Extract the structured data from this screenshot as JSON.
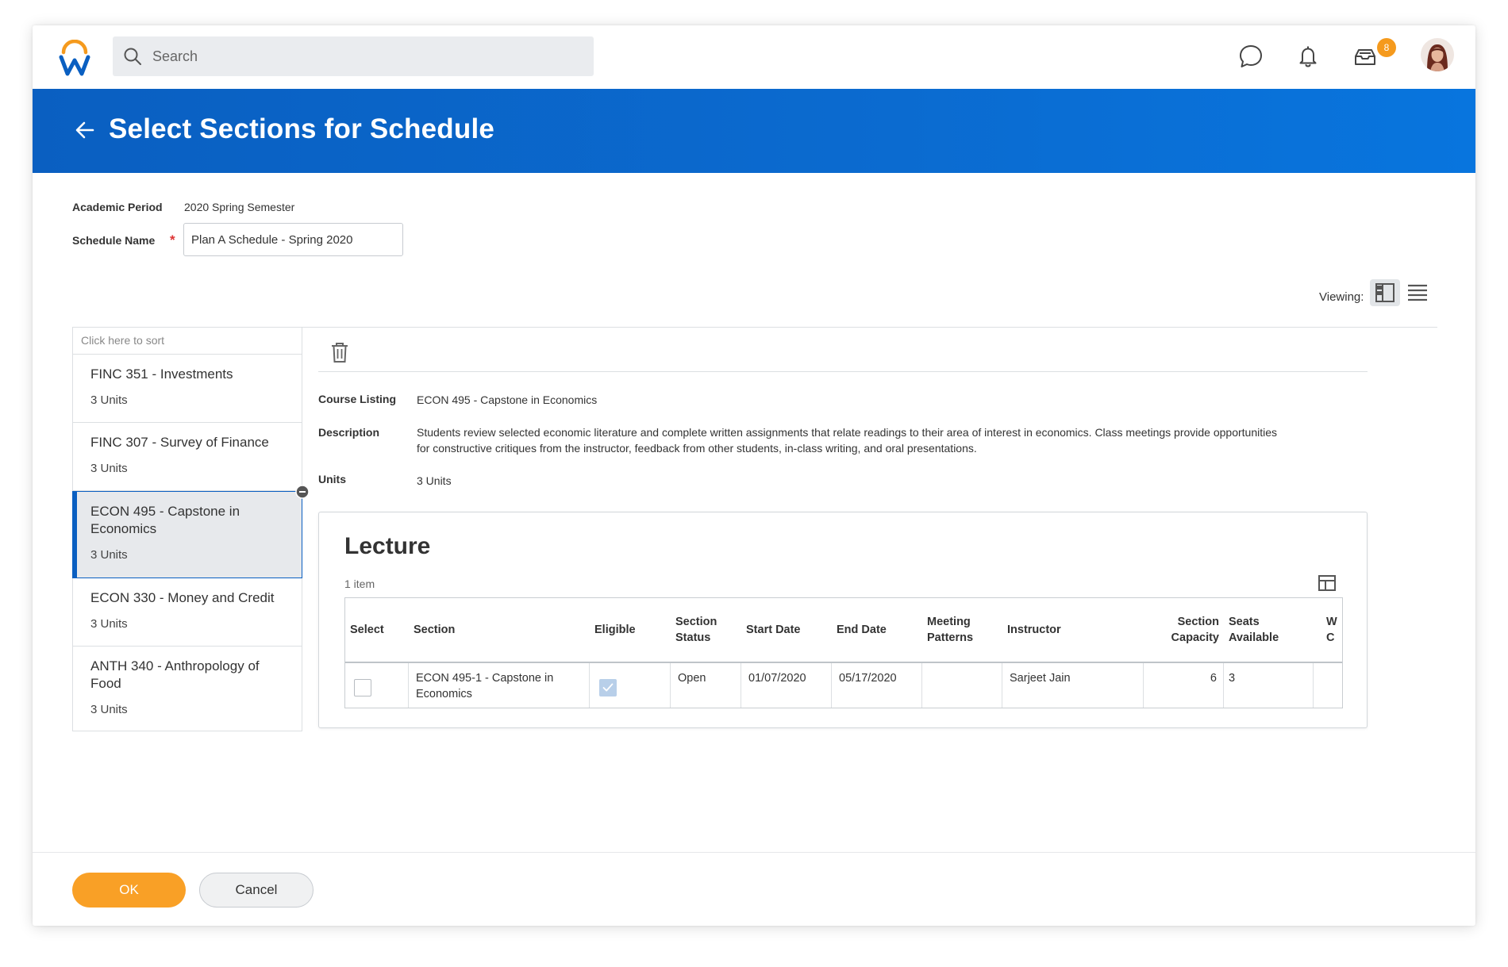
{
  "topnav": {
    "search_placeholder": "Search",
    "inbox_badge": "8"
  },
  "header": {
    "title": "Select Sections for Schedule"
  },
  "form": {
    "academic_period_label": "Academic Period",
    "academic_period_value": "2020 Spring Semester",
    "schedule_name_label": "Schedule Name",
    "required_marker": "*",
    "schedule_name_value": "Plan A Schedule - Spring 2020"
  },
  "viewing": {
    "label": "Viewing:"
  },
  "course_list": {
    "sort_hint": "Click here to sort",
    "items": [
      {
        "name": "FINC 351 - Investments",
        "units": "3 Units"
      },
      {
        "name": "FINC 307 - Survey of Finance",
        "units": "3 Units"
      },
      {
        "name": "ECON 495 - Capstone in Economics",
        "units": "3 Units"
      },
      {
        "name": "ECON 330 - Money and Credit",
        "units": "3 Units"
      },
      {
        "name": "ANTH 340 - Anthropology of Food",
        "units": "3 Units"
      }
    ]
  },
  "detail": {
    "course_listing_label": "Course Listing",
    "course_listing_value": "ECON 495 - Capstone in Economics",
    "description_label": "Description",
    "description_line1": "Students review selected economic literature and complete written assignments that relate readings to their area of interest in economics. Class meetings provide opportunities",
    "description_line2": "for constructive critiques from the instructor, feedback from other students, in-class writing, and oral presentations.",
    "units_label": "Units",
    "units_value": "3 Units"
  },
  "lecture": {
    "title": "Lecture",
    "item_count": "1 item",
    "columns": {
      "select": "Select",
      "section": "Section",
      "eligible": "Eligible",
      "status_1": "Section",
      "status_2": "Status",
      "start": "Start Date",
      "end": "End Date",
      "meeting_1": "Meeting",
      "meeting_2": "Patterns",
      "instructor": "Instructor",
      "capacity_1": "Section",
      "capacity_2": "Capacity",
      "seats_1": "Seats",
      "seats_2": "Available",
      "waitlist_1": "W",
      "waitlist_2": "C"
    },
    "row": {
      "selected": false,
      "section_1": "ECON 495-1 - Capstone in",
      "section_2": "Economics",
      "eligible": true,
      "status": "Open",
      "start": "01/07/2020",
      "end": "05/17/2020",
      "meeting": "",
      "instructor": "Sarjeet Jain",
      "capacity": "6",
      "seats": "3"
    }
  },
  "footer": {
    "ok_label": "OK",
    "cancel_label": "Cancel"
  },
  "colors": {
    "header_blue": "#0a5fc1",
    "ok_orange": "#f9a026",
    "badge_orange": "#f59a1d"
  }
}
